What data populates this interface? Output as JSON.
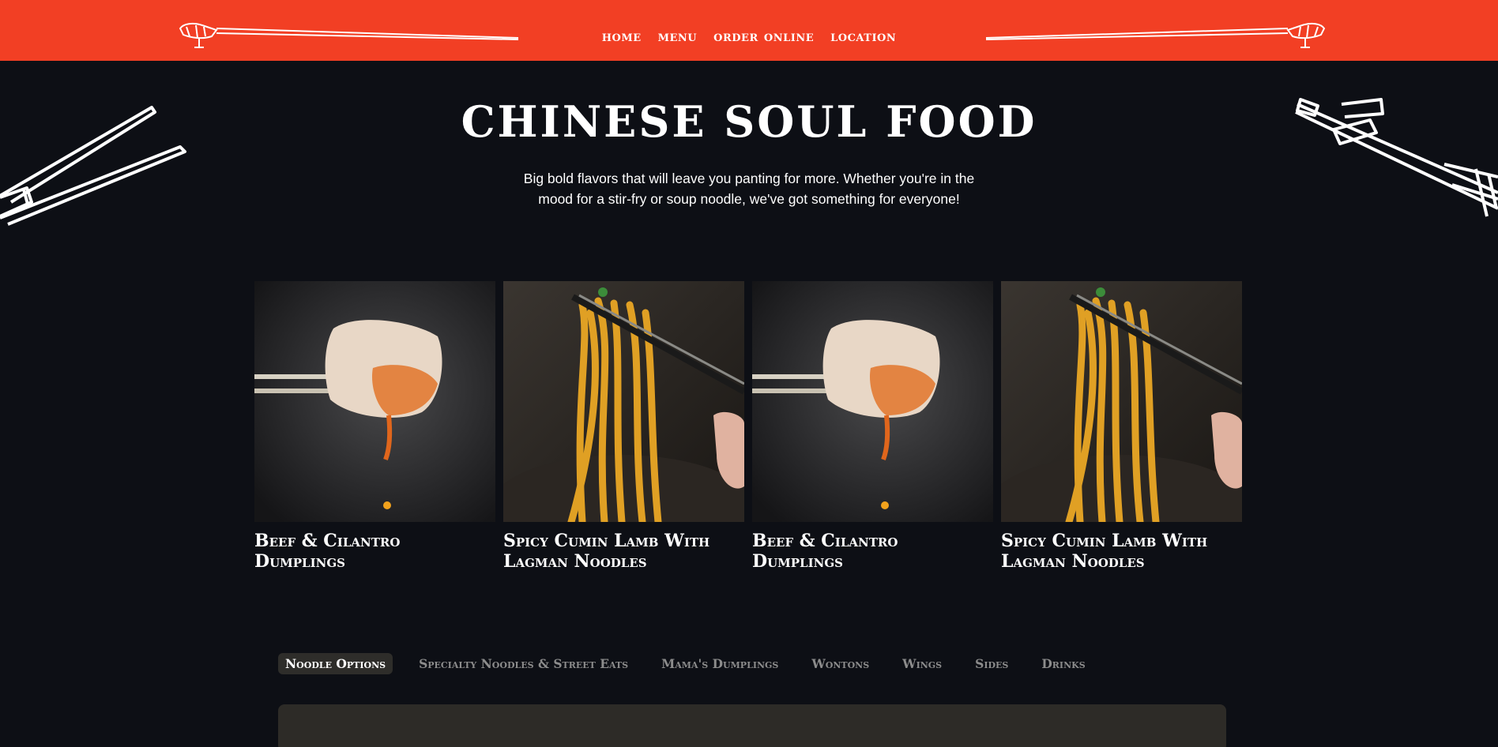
{
  "nav": {
    "items": [
      {
        "label": "HOME"
      },
      {
        "label": "MENU"
      },
      {
        "label": "ORDER ONLINE"
      },
      {
        "label": "LOCATION"
      }
    ]
  },
  "hero": {
    "title": "CHINESE SOUL FOOD",
    "subtitle": "Big bold flavors that will leave you panting for more. Whether you're in the mood for a stir-fry or soup noodle, we've got something for everyone!"
  },
  "cards": [
    {
      "title": "Beef & Cilantro Dumplings",
      "image": "dumpling-chopsticks-photo"
    },
    {
      "title": "Spicy Cumin Lamb With Lagman Noodles",
      "image": "noodles-chopsticks-photo"
    },
    {
      "title": "Beef & Cilantro Dumplings",
      "image": "dumpling-chopsticks-photo"
    },
    {
      "title": "Spicy Cumin Lamb With Lagman Noodles",
      "image": "noodles-chopsticks-photo"
    }
  ],
  "menu_tabs": [
    {
      "label": "Noodle Options",
      "active": true
    },
    {
      "label": "Specialty Noodles & Street Eats",
      "active": false
    },
    {
      "label": "Mama's Dumplings",
      "active": false
    },
    {
      "label": "Wontons",
      "active": false
    },
    {
      "label": "Wings",
      "active": false
    },
    {
      "label": "Sides",
      "active": false
    },
    {
      "label": "Drinks",
      "active": false
    }
  ],
  "colors": {
    "nav_bg": "#f23f24",
    "page_bg": "#0d0f15",
    "active_tab_bg": "#2e2d2a",
    "inactive_tab_text": "#8c8c8c",
    "panel_bg": "#2d2b27"
  }
}
